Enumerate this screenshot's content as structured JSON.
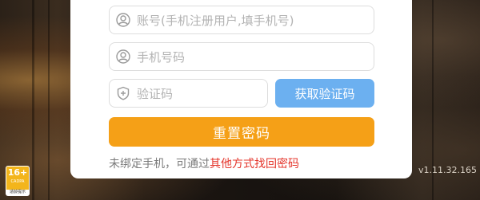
{
  "form": {
    "account_placeholder": "账号(手机注册用户,填手机号)",
    "phone_placeholder": "手机号码",
    "code_placeholder": "验证码",
    "get_code_label": "获取验证码",
    "reset_label": "重置密码"
  },
  "hint": {
    "text": "未绑定手机，可通过",
    "link": "其他方式找回密码"
  },
  "age_badge": {
    "age": "16+",
    "org": "CADPA",
    "notice": "适龄提示"
  },
  "version": "v1.11.32.165",
  "icons": {
    "account": "user-icon",
    "phone": "user-icon",
    "code": "shield-icon"
  },
  "colors": {
    "primary_orange": "#f5a017",
    "code_button_blue": "#6cb0f0",
    "link_red": "#e4342a"
  }
}
